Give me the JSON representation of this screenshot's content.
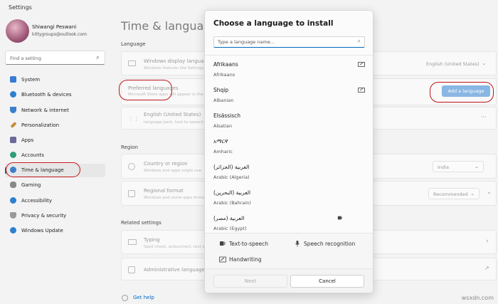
{
  "window": {
    "title": "Settings"
  },
  "user": {
    "name": "Shiwangi Peswani",
    "email": "kittygroups@outlook.com"
  },
  "search": {
    "placeholder": "Find a setting"
  },
  "sidebar": {
    "items": [
      {
        "label": "System",
        "icon": "system-icon",
        "color": "#3a7bd5"
      },
      {
        "label": "Bluetooth & devices",
        "icon": "bluetooth-icon",
        "color": "#2d7fd0"
      },
      {
        "label": "Network & internet",
        "icon": "network-icon",
        "color": "#3b80c8"
      },
      {
        "label": "Personalization",
        "icon": "brush-icon",
        "color": "#c98a38"
      },
      {
        "label": "Apps",
        "icon": "apps-icon",
        "color": "#6a6a9a"
      },
      {
        "label": "Accounts",
        "icon": "accounts-icon",
        "color": "#2e9e7a"
      },
      {
        "label": "Time & language",
        "icon": "time-language-icon",
        "color": "#3b80c8"
      },
      {
        "label": "Gaming",
        "icon": "gaming-icon",
        "color": "#777"
      },
      {
        "label": "Accessibility",
        "icon": "accessibility-icon",
        "color": "#2d7fd0"
      },
      {
        "label": "Privacy & security",
        "icon": "shield-icon",
        "color": "#777"
      },
      {
        "label": "Windows Update",
        "icon": "windows-update-icon",
        "color": "#2d7fd0"
      }
    ]
  },
  "main": {
    "title": "Time & language",
    "language_section": "Language",
    "display_language": {
      "title": "Windows display language",
      "subtitle": "Windows features like Settings",
      "value": "English (United States)"
    },
    "preferred": {
      "title": "Preferred languages",
      "subtitle": "Microsoft Store apps will appear in the",
      "button": "Add a language"
    },
    "english": {
      "title": "English (United States)",
      "subtitle": "language pack, text-to-speech",
      "more": "···"
    },
    "region_section": "Region",
    "country": {
      "title": "Country or region",
      "subtitle": "Windows and apps might use",
      "value": "India"
    },
    "regional_format": {
      "title": "Regional format",
      "subtitle": "Windows and some apps format",
      "value": "Recommended"
    },
    "related_section": "Related settings",
    "typing": {
      "title": "Typing",
      "subtitle": "Spell check, autocorrect, text sug"
    },
    "admin": {
      "title": "Administrative language se"
    },
    "help": "Get help"
  },
  "dialog": {
    "title": "Choose a language to install",
    "search_placeholder": "Type a language name...",
    "languages": [
      {
        "name": "Afrikaans",
        "english": "Afrikaans",
        "feature_icon": "display-language-icon"
      },
      {
        "name": "Shqip",
        "english": "Albanian",
        "feature_icon": "display-language-icon"
      },
      {
        "name": "Elsässisch",
        "english": "Alsatian",
        "feature_icon": ""
      },
      {
        "name": "አማርኛ",
        "english": "Amharic",
        "feature_icon": ""
      },
      {
        "name": "العربية (الجزائر)",
        "english": "Arabic (Algeria)",
        "feature_icon": ""
      },
      {
        "name": "العربية (البحرين)",
        "english": "Arabic (Bahrain)",
        "feature_icon": ""
      },
      {
        "name": "العربية (مصر)",
        "english": "Arabic (Egypt)",
        "feature_icon": "text-to-speech-icon"
      }
    ],
    "features": {
      "tts": "Text-to-speech",
      "speech": "Speech recognition",
      "handwriting": "Handwriting"
    },
    "next": "Next",
    "cancel": "Cancel"
  },
  "watermark": "wsxdn.com"
}
